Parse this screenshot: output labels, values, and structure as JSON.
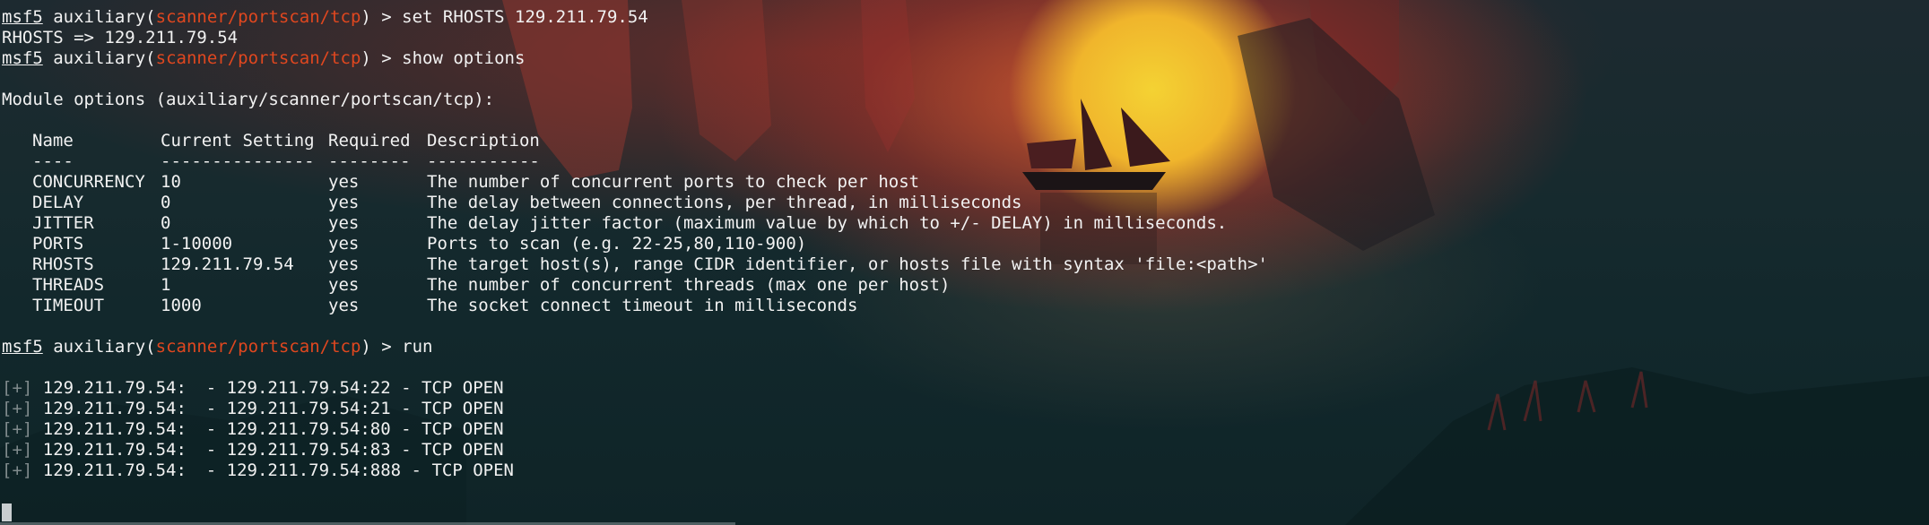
{
  "terminal": {
    "prompt_host": "msf5",
    "prompt_word": "auxiliary",
    "module_path": "scanner/portscan/tcp",
    "prompt_suffix": ") > ",
    "commands": [
      "set RHOSTS 129.211.79.54",
      "show options",
      "run"
    ],
    "echo_line": "RHOSTS => 129.211.79.54",
    "module_options_header": "Module options (auxiliary/scanner/portscan/tcp):",
    "options_table": {
      "headers": [
        "Name",
        "Current Setting",
        "Required",
        "Description"
      ],
      "separators": [
        "----",
        "---------------",
        "--------",
        "-----------"
      ],
      "rows": [
        {
          "name": "CONCURRENCY",
          "setting": "10",
          "required": "yes",
          "description": "The number of concurrent ports to check per host"
        },
        {
          "name": "DELAY",
          "setting": "0",
          "required": "yes",
          "description": "The delay between connections, per thread, in milliseconds"
        },
        {
          "name": "JITTER",
          "setting": "0",
          "required": "yes",
          "description": "The delay jitter factor (maximum value by which to +/- DELAY) in milliseconds."
        },
        {
          "name": "PORTS",
          "setting": "1-10000",
          "required": "yes",
          "description": "Ports to scan (e.g. 22-25,80,110-900)"
        },
        {
          "name": "RHOSTS",
          "setting": "129.211.79.54",
          "required": "yes",
          "description": "The target host(s), range CIDR identifier, or hosts file with syntax 'file:<path>'"
        },
        {
          "name": "THREADS",
          "setting": "1",
          "required": "yes",
          "description": "The number of concurrent threads (max one per host)"
        },
        {
          "name": "TIMEOUT",
          "setting": "1000",
          "required": "yes",
          "description": "The socket connect timeout in milliseconds"
        }
      ]
    },
    "results": [
      {
        "marker": "[+]",
        "host": "129.211.79.54:",
        "text": "- 129.211.79.54:22 - TCP OPEN"
      },
      {
        "marker": "[+]",
        "host": "129.211.79.54:",
        "text": "- 129.211.79.54:21 - TCP OPEN"
      },
      {
        "marker": "[+]",
        "host": "129.211.79.54:",
        "text": "- 129.211.79.54:80 - TCP OPEN"
      },
      {
        "marker": "[+]",
        "host": "129.211.79.54:",
        "text": "- 129.211.79.54:83 - TCP OPEN"
      },
      {
        "marker": "[+]",
        "host": "129.211.79.54:",
        "text": "- 129.211.79.54:888 - TCP OPEN"
      }
    ]
  }
}
